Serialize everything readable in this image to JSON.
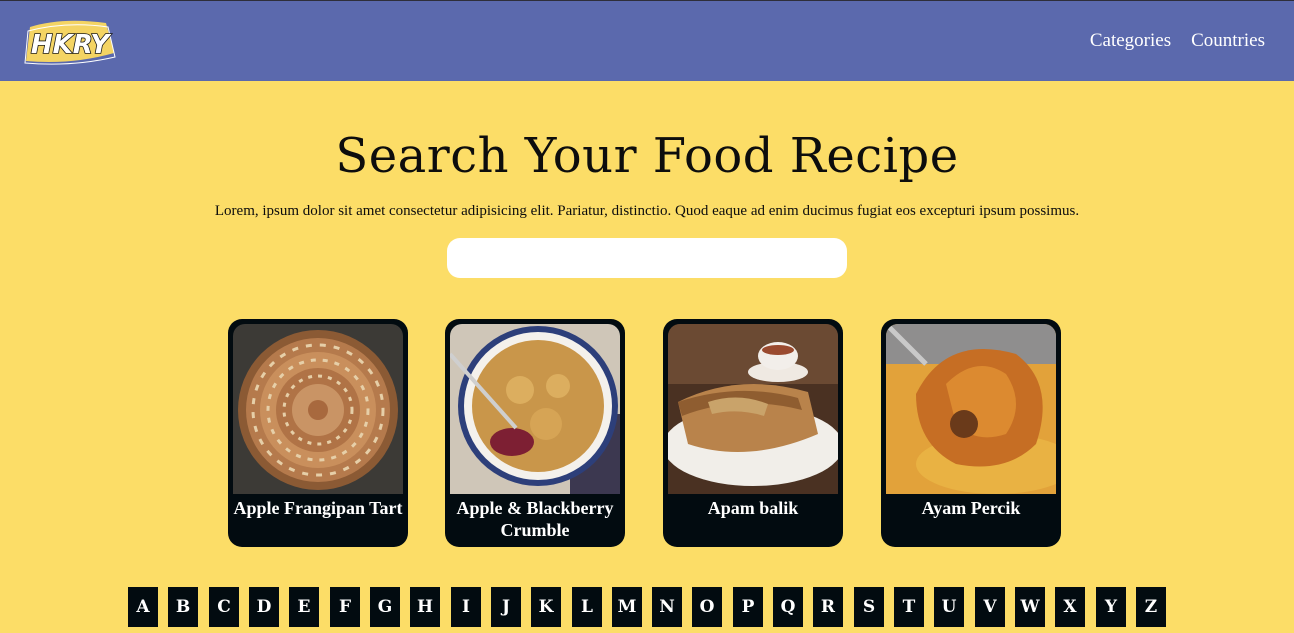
{
  "header": {
    "logo_text": "HKRY",
    "nav_links": [
      "Categories",
      "Countries"
    ]
  },
  "hero": {
    "title": "Search Your Food Recipe",
    "description": "Lorem, ipsum dolor sit amet consectetur adipisicing elit. Pariatur, distinctio. Quod eaque ad enim ducimus fugiat eos excepturi ipsum possimus.",
    "search_value": "",
    "search_placeholder": ""
  },
  "cards": [
    {
      "title": "Apple Frangipan Tart"
    },
    {
      "title": "Apple & Blackberry Crumble"
    },
    {
      "title": "Apam balik"
    },
    {
      "title": "Ayam Percik"
    }
  ],
  "alphabet": [
    "A",
    "B",
    "C",
    "D",
    "E",
    "F",
    "G",
    "H",
    "I",
    "J",
    "K",
    "L",
    "M",
    "N",
    "O",
    "P",
    "Q",
    "R",
    "S",
    "T",
    "U",
    "V",
    "W",
    "X",
    "Y",
    "Z"
  ],
  "colors": {
    "navbar": "#5b69ad",
    "background": "#fcdd67",
    "card": "#020b10"
  }
}
